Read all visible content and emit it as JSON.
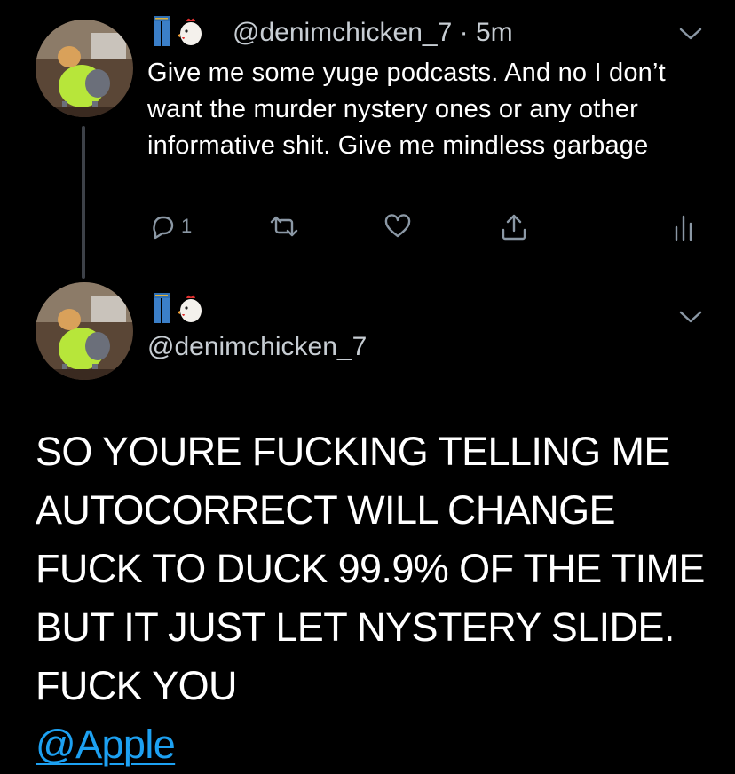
{
  "reply_tweet": {
    "handle": "@denimchicken_7",
    "separator": " · ",
    "time": "5m",
    "text": "Give me some yuge podcasts. And no I don’t want the murder nystery ones or any other informative shit. Give me mindless garbage",
    "reply_count": "1",
    "icons": [
      "jeans-emoji",
      "chicken-emoji",
      "reply-icon",
      "retweet-icon",
      "like-icon",
      "share-icon",
      "analytics-icon",
      "chevron-down-icon"
    ]
  },
  "main_tweet": {
    "handle": "@denimchicken_7",
    "body": "SO YOURE FUCKING TELLING ME AUTOCORRECT WILL CHANGE FUCK TO DUCK 99.9% OF THE TIME BUT IT JUST LET NYSTERY SLIDE. FUCK YOU",
    "mention": "@Apple",
    "icons": [
      "jeans-emoji",
      "chicken-emoji",
      "chevron-down-icon"
    ]
  },
  "colors": {
    "background": "#000000",
    "text": "#ffffff",
    "secondary": "#8b98a5",
    "link": "#1da1f2",
    "thread_line": "#3d4148"
  }
}
